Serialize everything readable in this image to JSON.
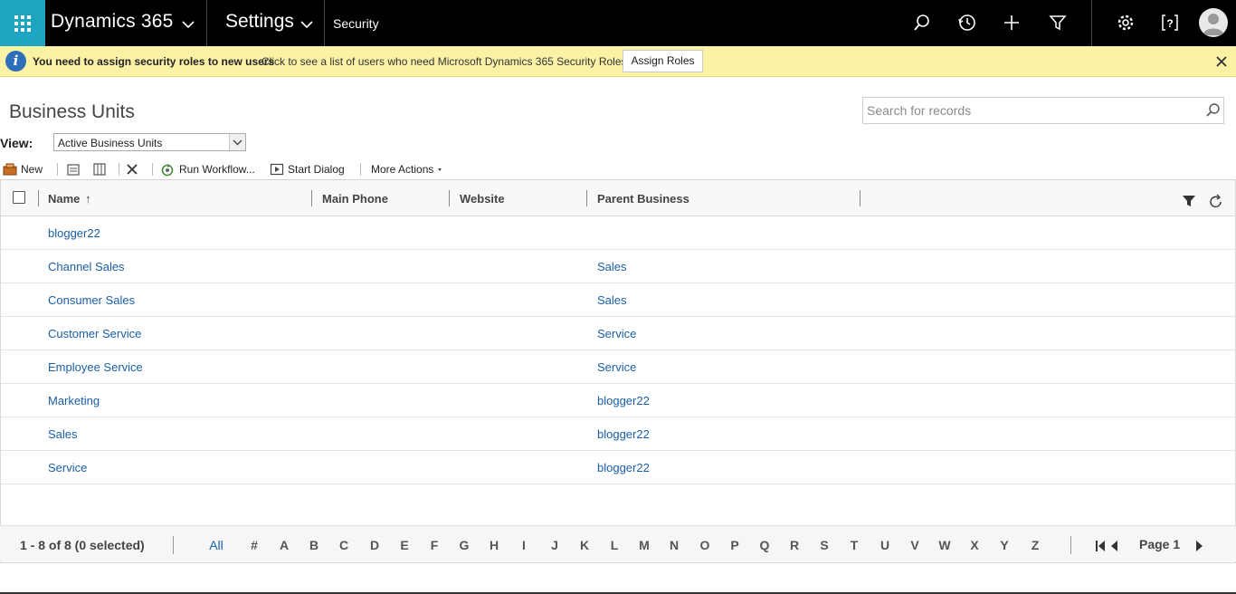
{
  "topbar": {
    "app_name": "Dynamics 365",
    "area": "Settings",
    "breadcrumb": "Security"
  },
  "notification": {
    "title": "You need to assign security roles to new users",
    "message": "Click to see a list of users who need Microsoft Dynamics 365 Security Roles.",
    "button_label": "Assign Roles"
  },
  "page": {
    "title": "Business Units",
    "search_placeholder": "Search for records",
    "view_label": "View:",
    "view_selected": "Active Business Units"
  },
  "commands": {
    "new": "New",
    "run_workflow": "Run Workflow...",
    "start_dialog": "Start Dialog",
    "more_actions": "More Actions"
  },
  "grid": {
    "columns": [
      "Name",
      "Main Phone",
      "Website",
      "Parent Business"
    ],
    "sort_indicator": "↑",
    "rows": [
      {
        "name": "blogger22",
        "phone": "",
        "website": "",
        "parent": ""
      },
      {
        "name": "Channel Sales",
        "phone": "",
        "website": "",
        "parent": "Sales"
      },
      {
        "name": "Consumer Sales",
        "phone": "",
        "website": "",
        "parent": "Sales"
      },
      {
        "name": "Customer Service",
        "phone": "",
        "website": "",
        "parent": "Service"
      },
      {
        "name": "Employee Service",
        "phone": "",
        "website": "",
        "parent": "Service"
      },
      {
        "name": "Marketing",
        "phone": "",
        "website": "",
        "parent": "blogger22"
      },
      {
        "name": "Sales",
        "phone": "",
        "website": "",
        "parent": "blogger22"
      },
      {
        "name": "Service",
        "phone": "",
        "website": "",
        "parent": "blogger22"
      }
    ]
  },
  "footer": {
    "status": "1 - 8 of 8 (0 selected)",
    "letters": [
      "All",
      "#",
      "A",
      "B",
      "C",
      "D",
      "E",
      "F",
      "G",
      "H",
      "I",
      "J",
      "K",
      "L",
      "M",
      "N",
      "O",
      "P",
      "Q",
      "R",
      "S",
      "T",
      "U",
      "V",
      "W",
      "X",
      "Y",
      "Z"
    ],
    "page_label": "Page 1"
  },
  "colors": {
    "accent": "#1ea5c1",
    "link": "#1a5fa8",
    "notification_bg": "#fbf2a6",
    "topbar_bg": "#000000"
  }
}
